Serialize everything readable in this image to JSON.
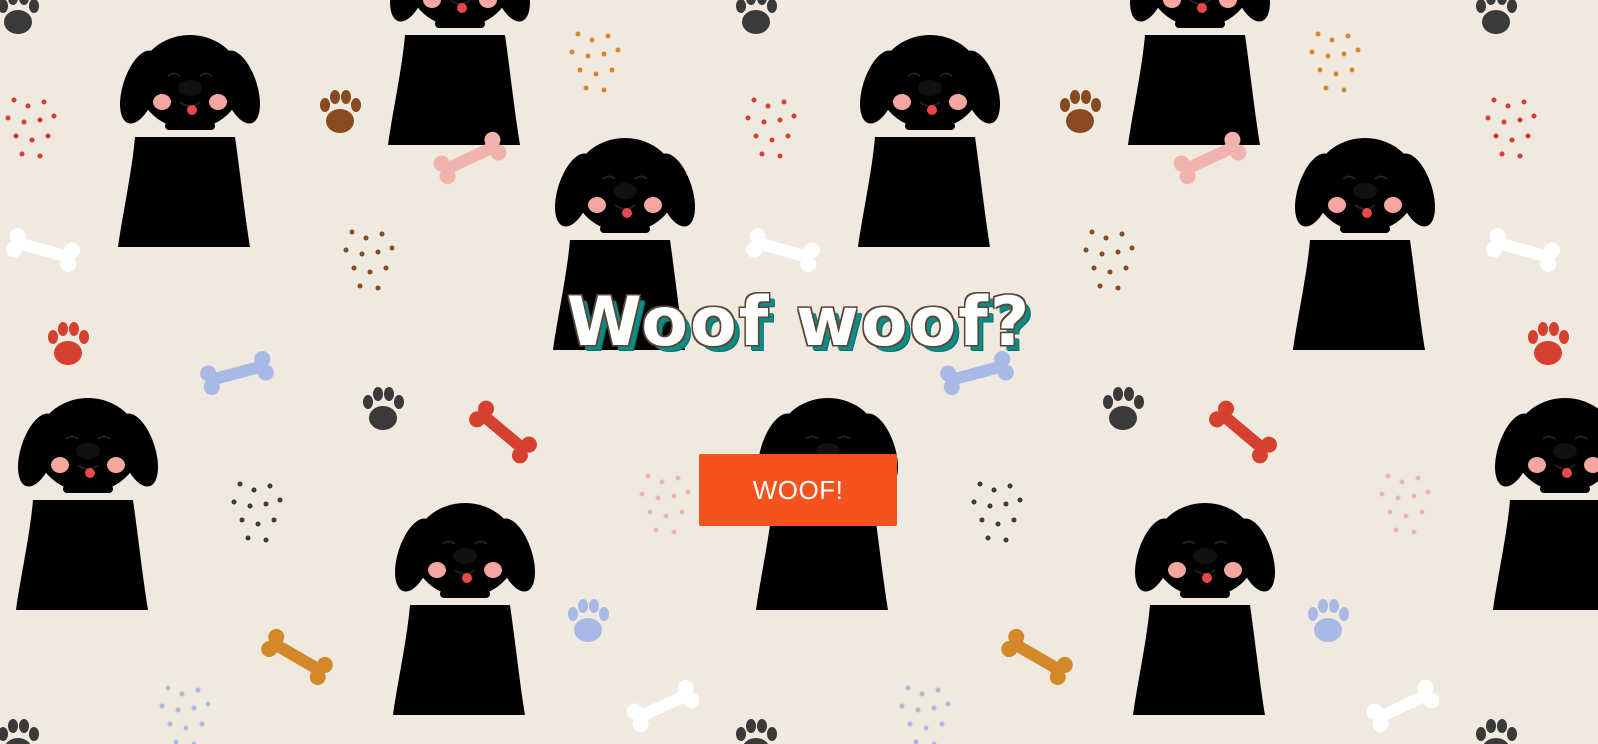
{
  "page": {
    "heading": "Woof woof?",
    "button_label": "WOOF!"
  },
  "colors": {
    "background": "#efe9df",
    "button": "#f4521e",
    "heading_shadow": "#0e8b85",
    "dog_gold": "#d3892a",
    "dog_brown": "#8a4a1f",
    "dog_gray": "#7a7a7a",
    "dog_light_gray": "#aaaaaa",
    "bone_white": "#ffffff",
    "bone_pink": "#f0b3ad",
    "bone_blue": "#a9b9e6",
    "bone_red": "#d6402f",
    "bone_orange": "#d3892a",
    "paw_dark": "#3a3a3a",
    "paw_brown": "#8a4a1f",
    "paw_red": "#d6402f",
    "paw_blue": "#a9b9e6"
  },
  "background": {
    "pattern": "cartoon-dogs",
    "icons": [
      "dog-icon",
      "bone-icon",
      "paw-print-icon",
      "dots-icon"
    ]
  }
}
